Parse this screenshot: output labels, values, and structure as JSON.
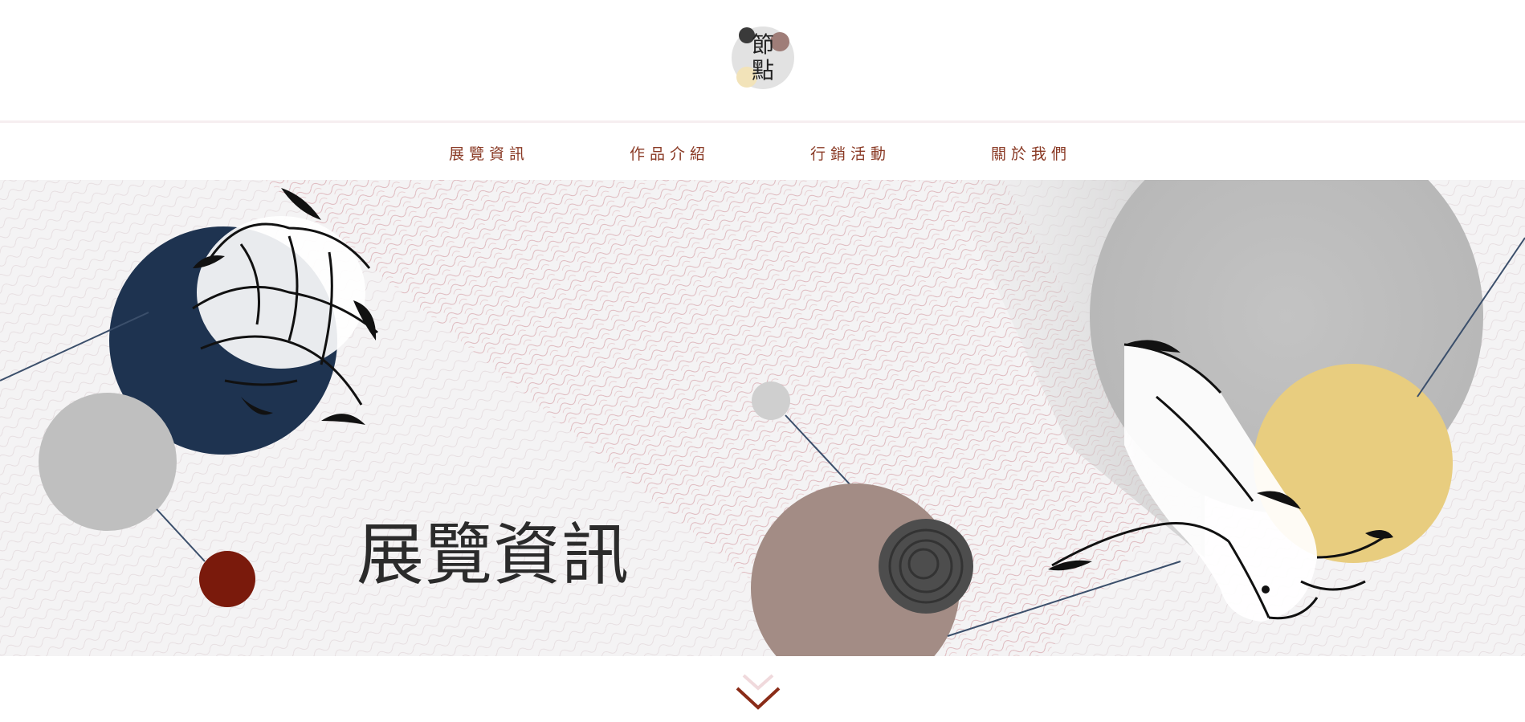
{
  "brand": {
    "logo_text_line1": "節",
    "logo_text_line2": "點",
    "icon": "logo-circles-icon"
  },
  "nav": {
    "items": [
      {
        "label": "展覽資訊"
      },
      {
        "label": "作品介紹"
      },
      {
        "label": "行銷活動"
      },
      {
        "label": "關於我們"
      }
    ]
  },
  "hero": {
    "title": "展覽資訊"
  },
  "scroll": {
    "icon": "chevron-down-icon"
  },
  "colors": {
    "nav_text": "#8a3a25",
    "navy": "#1e3350",
    "red": "#7a1a0c",
    "gold": "#e9cf82",
    "taupe": "#a38c85",
    "grey": "#c9c9c9",
    "dark_grey": "#555555"
  }
}
